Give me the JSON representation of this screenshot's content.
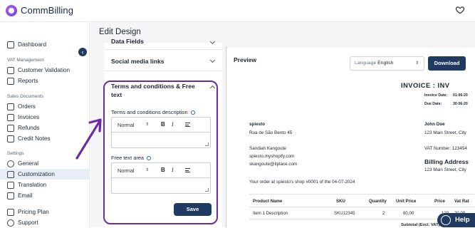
{
  "app": {
    "brand": "CommBilling"
  },
  "sidebar": {
    "collapse_glyph": "‹",
    "top_item": {
      "label": "Dashboard",
      "icon": "home-icon"
    },
    "sections": [
      {
        "title": "VAT Management",
        "items": [
          {
            "label": "Customer Validation",
            "icon": "checklist-icon"
          },
          {
            "label": "Reports",
            "icon": "report-icon"
          }
        ]
      },
      {
        "title": "Sales Documents",
        "items": [
          {
            "label": "Orders",
            "icon": "orders-icon"
          },
          {
            "label": "Invoices",
            "icon": "invoice-icon"
          },
          {
            "label": "Refunds",
            "icon": "refund-icon"
          },
          {
            "label": "Credit Notes",
            "icon": "credit-note-icon"
          }
        ]
      },
      {
        "title": "Settings",
        "items": [
          {
            "label": "General",
            "icon": "gear-icon"
          },
          {
            "label": "Customization",
            "icon": "customization-icon",
            "active": true
          },
          {
            "label": "Translation",
            "icon": "translation-icon"
          },
          {
            "label": "Email",
            "icon": "email-icon"
          }
        ]
      }
    ],
    "bottom_items": [
      {
        "label": "Pricing Plan",
        "icon": "pricing-icon"
      },
      {
        "label": "Support",
        "icon": "support-icon"
      }
    ]
  },
  "main": {
    "title": "Edit Design"
  },
  "design_panel": {
    "accordions": [
      {
        "label": "Data Fields",
        "expanded": false
      },
      {
        "label": "Social media links",
        "expanded": false
      },
      {
        "label": "Terms and conditions & Free text",
        "expanded": true
      }
    ],
    "terms_label": "Terms and conditions description",
    "free_text_label": "Free text area",
    "editor_format": "Normal",
    "toolbar": {
      "bold": "B",
      "italic": "I"
    },
    "save_label": "Save"
  },
  "preview": {
    "title": "Preview",
    "language_placeholder": "Language",
    "language_value": "English",
    "download_label": "Download",
    "invoice_title": "INVOICE : INV",
    "invoice_date_label": "Invoice Date:",
    "invoice_date_value": "01-06-20",
    "due_date_label": "Due Date:",
    "due_date_value": "30-06-20",
    "seller": {
      "name": "spiesto",
      "address": "Rua de São Bento 45",
      "contact": "Sandiah Kangoute",
      "site": "spiesto.myshopify.com",
      "email": "skangoute@itplace.com"
    },
    "buyer": {
      "name": "John Doe",
      "address": "123 Main Street, City",
      "vat": "VAT Number: 123454",
      "address2": "123 Main Street, City"
    },
    "billing_heading": "Billing Address",
    "order_line": "Your order at spiesto's shop #0001 of the 04-07-2024",
    "table": {
      "headers": [
        "Product Name",
        "SKU",
        "Quantity",
        "Unit Price",
        "Price",
        "Vat Rat"
      ],
      "row": [
        "Item 1 Description",
        "SKU12345",
        "2",
        "60,00",
        "120,",
        "20,00 "
      ]
    },
    "subtotal_label": "Subtotal (Excl. VAT)"
  },
  "help": {
    "label": "Help"
  },
  "colors": {
    "primary": "#1f3a63",
    "highlight": "#6b2aa8"
  }
}
